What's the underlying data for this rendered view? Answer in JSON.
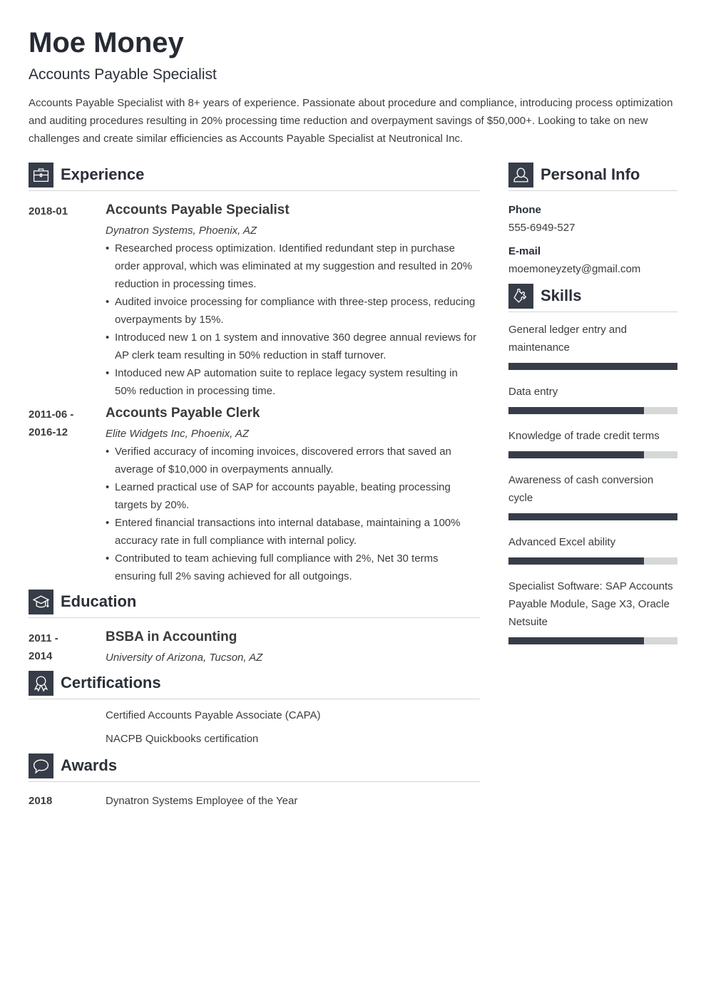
{
  "header": {
    "name": "Moe Money",
    "title": "Accounts Payable Specialist",
    "summary": "Accounts Payable Specialist with 8+ years of experience. Passionate about procedure and compliance, introducing process optimization and auditing procedures resulting in 20% processing time reduction and overpayment savings of $50,000+. Looking to take on new challenges and create similar efficiencies as Accounts Payable Specialist at Neutronical Inc."
  },
  "experience": {
    "heading": "Experience",
    "icon": "briefcase-icon",
    "items": [
      {
        "date": "2018-01",
        "title": "Accounts Payable Specialist",
        "company": "Dynatron Systems, Phoenix, AZ",
        "bullets": [
          "Researched process optimization. Identified redundant step in purchase order approval, which was eliminated at my suggestion and resulted in 20% reduction in processing times.",
          "Audited invoice processing for compliance with three-step process, reducing overpayments by 15%.",
          "Introduced new 1 on 1 system and innovative 360 degree annual reviews for AP clerk team resulting in 50% reduction in staff turnover.",
          "Intoduced new AP automation suite to replace legacy system resulting in 50% reduction in processing time."
        ]
      },
      {
        "date": "2011-06 - 2016-12",
        "title": "Accounts Payable Clerk",
        "company": "Elite Widgets Inc, Phoenix, AZ",
        "bullets": [
          "Verified accuracy of incoming invoices, discovered errors that saved an average of $10,000 in overpayments annually.",
          "Learned practical use of SAP for accounts payable, beating processing targets by 20%.",
          "Entered financial transactions into internal database, maintaining a 100% accuracy rate in full compliance with internal policy.",
          "Contributed to team achieving full compliance with 2%, Net 30 terms ensuring full 2% saving achieved for all outgoings."
        ]
      }
    ]
  },
  "education": {
    "heading": "Education",
    "icon": "graduation-cap-icon",
    "items": [
      {
        "date": "2011 - 2014",
        "degree": "BSBA in Accounting",
        "school": "University of Arizona, Tucson, AZ"
      }
    ]
  },
  "certifications": {
    "heading": "Certifications",
    "icon": "award-ribbon-icon",
    "items": [
      "Certified Accounts Payable Associate (CAPA)",
      "NACPB Quickbooks certification"
    ]
  },
  "awards": {
    "heading": "Awards",
    "icon": "speech-bubble-icon",
    "items": [
      {
        "date": "2018",
        "text": "Dynatron Systems Employee of the Year"
      }
    ]
  },
  "personal_info": {
    "heading": "Personal Info",
    "icon": "person-icon",
    "phone_label": "Phone",
    "phone": "555-6949-527",
    "email_label": "E-mail",
    "email": "moemoneyzety@gmail.com"
  },
  "skills": {
    "heading": "Skills",
    "icon": "puzzle-icon",
    "colors": {
      "fill": "#373d48",
      "track": "#d6d7d7"
    },
    "items": [
      {
        "name": "General ledger entry and maintenance",
        "level": 1.0
      },
      {
        "name": "Data entry",
        "level": 0.8
      },
      {
        "name": "Knowledge of trade credit terms",
        "level": 0.8
      },
      {
        "name": "Awareness of cash conversion cycle",
        "level": 1.0
      },
      {
        "name": "Advanced Excel ability",
        "level": 0.8
      },
      {
        "name": "Specialist Software: SAP Accounts Payable Module, Sage X3, Oracle Netsuite",
        "level": 0.8
      }
    ]
  }
}
